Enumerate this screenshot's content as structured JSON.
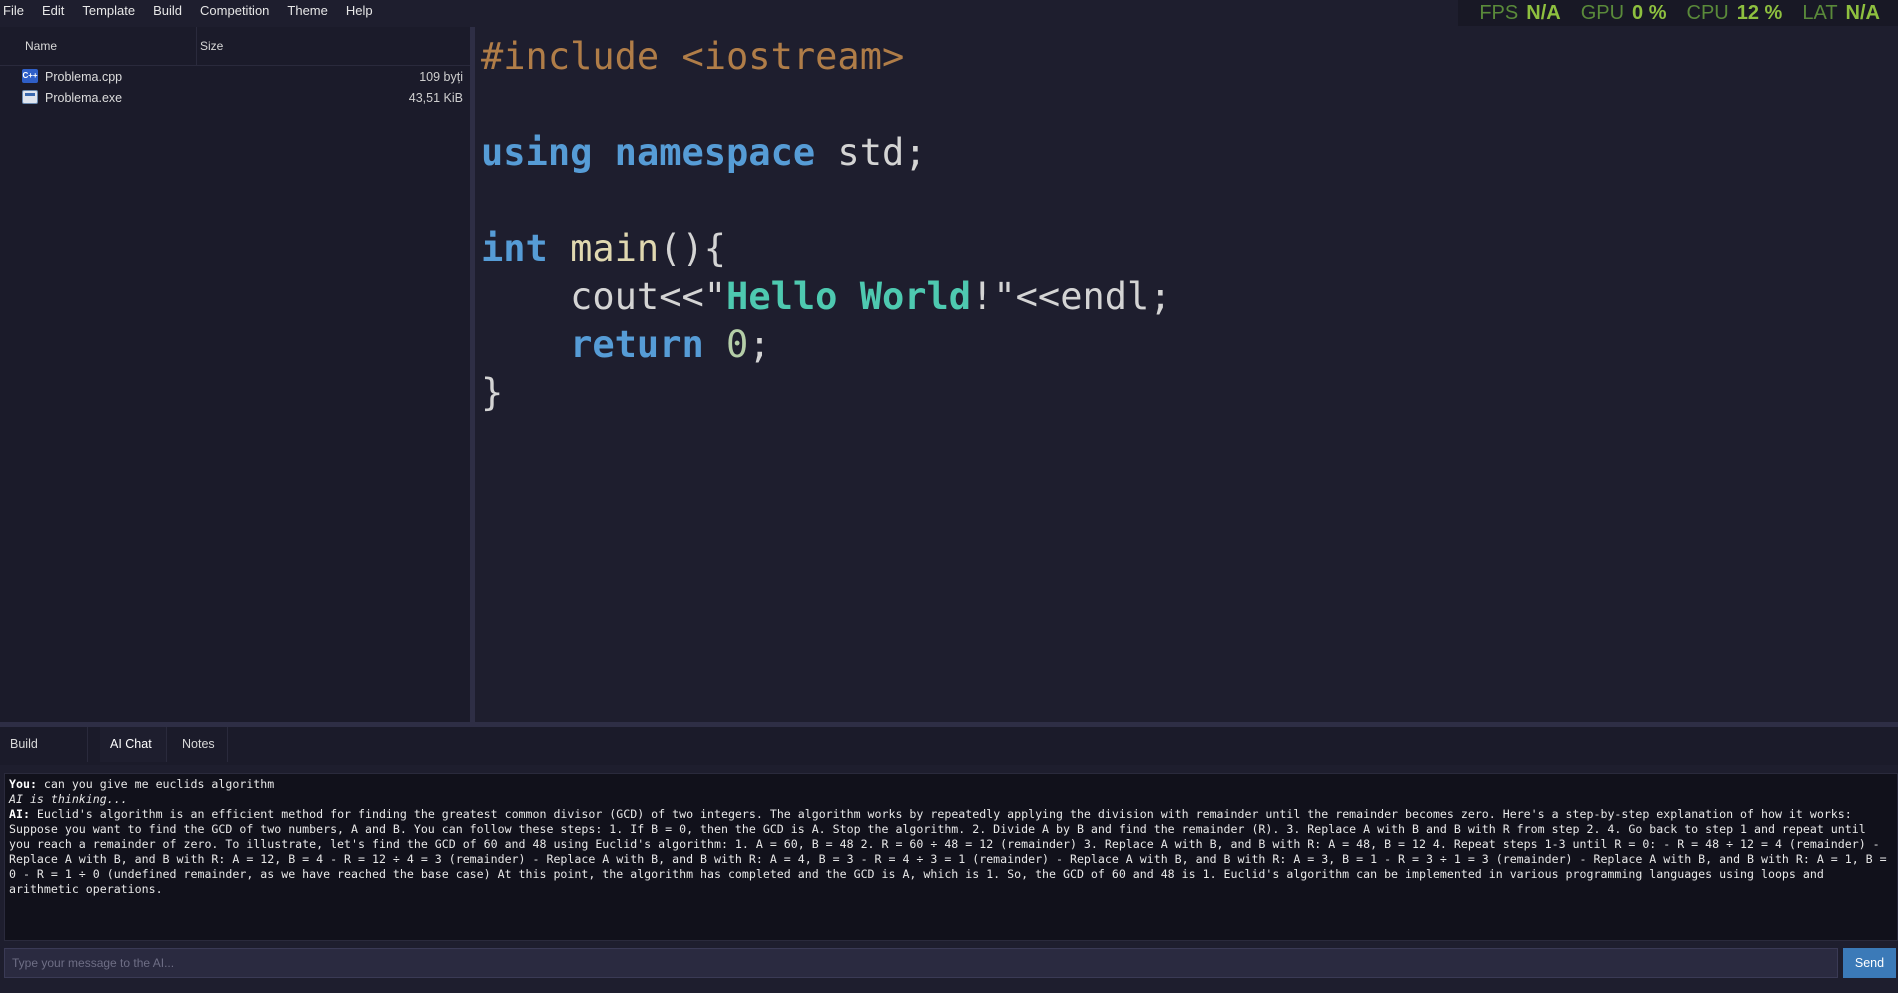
{
  "menu": {
    "items": [
      "File",
      "Edit",
      "Template",
      "Build",
      "Competition",
      "Theme",
      "Help"
    ]
  },
  "perf": {
    "fps_label": "FPS",
    "fps_value": "N/A",
    "gpu_label": "GPU",
    "gpu_value": "0 %",
    "cpu_label": "CPU",
    "cpu_value": "12 %",
    "lat_label": "LAT",
    "lat_value": "N/A"
  },
  "files": {
    "col_name": "Name",
    "col_size": "Size",
    "items": [
      {
        "name": "Problema.cpp",
        "size": "109 byți",
        "icon": "cpp-file-icon"
      },
      {
        "name": "Problema.exe",
        "size": "43,51 KiB",
        "icon": "exe-file-icon"
      }
    ]
  },
  "editor": {
    "line1": {
      "pre": "#include <iostream>"
    },
    "line3": {
      "kw1": "using",
      "kw2": "namespace",
      "rest": " std;"
    },
    "line5": {
      "kw": "int",
      "fn": "main",
      "rest": "(){"
    },
    "line6": {
      "indent": "    ",
      "a": "cout<<\"",
      "str": "Hello World",
      "b": "!\"<<endl;"
    },
    "line7": {
      "indent": "    ",
      "kw": "return",
      "num": "0",
      "rest": ";"
    },
    "line8": {
      "brace": "}"
    }
  },
  "tabs": {
    "build_output": "Build Output",
    "ai_chat": "AI Chat",
    "notes": "Notes"
  },
  "chat": {
    "you_label": "You:",
    "you_text": " can you give me euclids algorithm",
    "thinking": "AI is thinking...",
    "ai_label": "AI:",
    "ai_text": " Euclid's algorithm is an efficient method for finding the greatest common divisor (GCD) of two integers. The algorithm works by repeatedly applying the division with remainder until the remainder becomes zero. Here's a step-by-step explanation of how it works: Suppose you want to find the GCD of two numbers, A and B. You can follow these steps: 1. If B = 0, then the GCD is A. Stop the algorithm. 2. Divide A by B and find the remainder (R). 3. Replace A with B and B with R from step 2. 4. Go back to step 1 and repeat until you reach a remainder of zero. To illustrate, let's find the GCD of 60 and 48 using Euclid's algorithm: 1. A = 60, B = 48 2. R = 60 ÷ 48 = 12 (remainder) 3. Replace A with B, and B with R: A = 48, B = 12 4. Repeat steps 1-3 until R = 0: - R = 48 ÷ 12 = 4 (remainder) - Replace A with B, and B with R: A = 12, B = 4 - R = 12 ÷ 4 = 3 (remainder) - Replace A with B, and B with R: A = 4, B = 3 - R = 4 ÷ 3 = 1 (remainder) - Replace A with B, and B with R: A = 3, B = 1 - R = 3 ÷ 1 = 3 (remainder) - Replace A with B, and B with R: A = 1, B = 0 - R = 1 ÷ 0 (undefined remainder, as we have reached the base case) At this point, the algorithm has completed and the GCD is A, which is 1. So, the GCD of 60 and 48 is 1. Euclid's algorithm can be implemented in various programming languages using loops and arithmetic operations.",
    "input_placeholder": "Type your message to the AI...",
    "send_label": "Send"
  },
  "colors": {
    "background": "#1e1e2e",
    "panel": "#1b1b2a",
    "accent": "#3b7ab8",
    "perf_value": "#8ec03f",
    "keyword": "#569cd6",
    "string": "#4ec9b0",
    "preprocessor": "#b07d48"
  }
}
